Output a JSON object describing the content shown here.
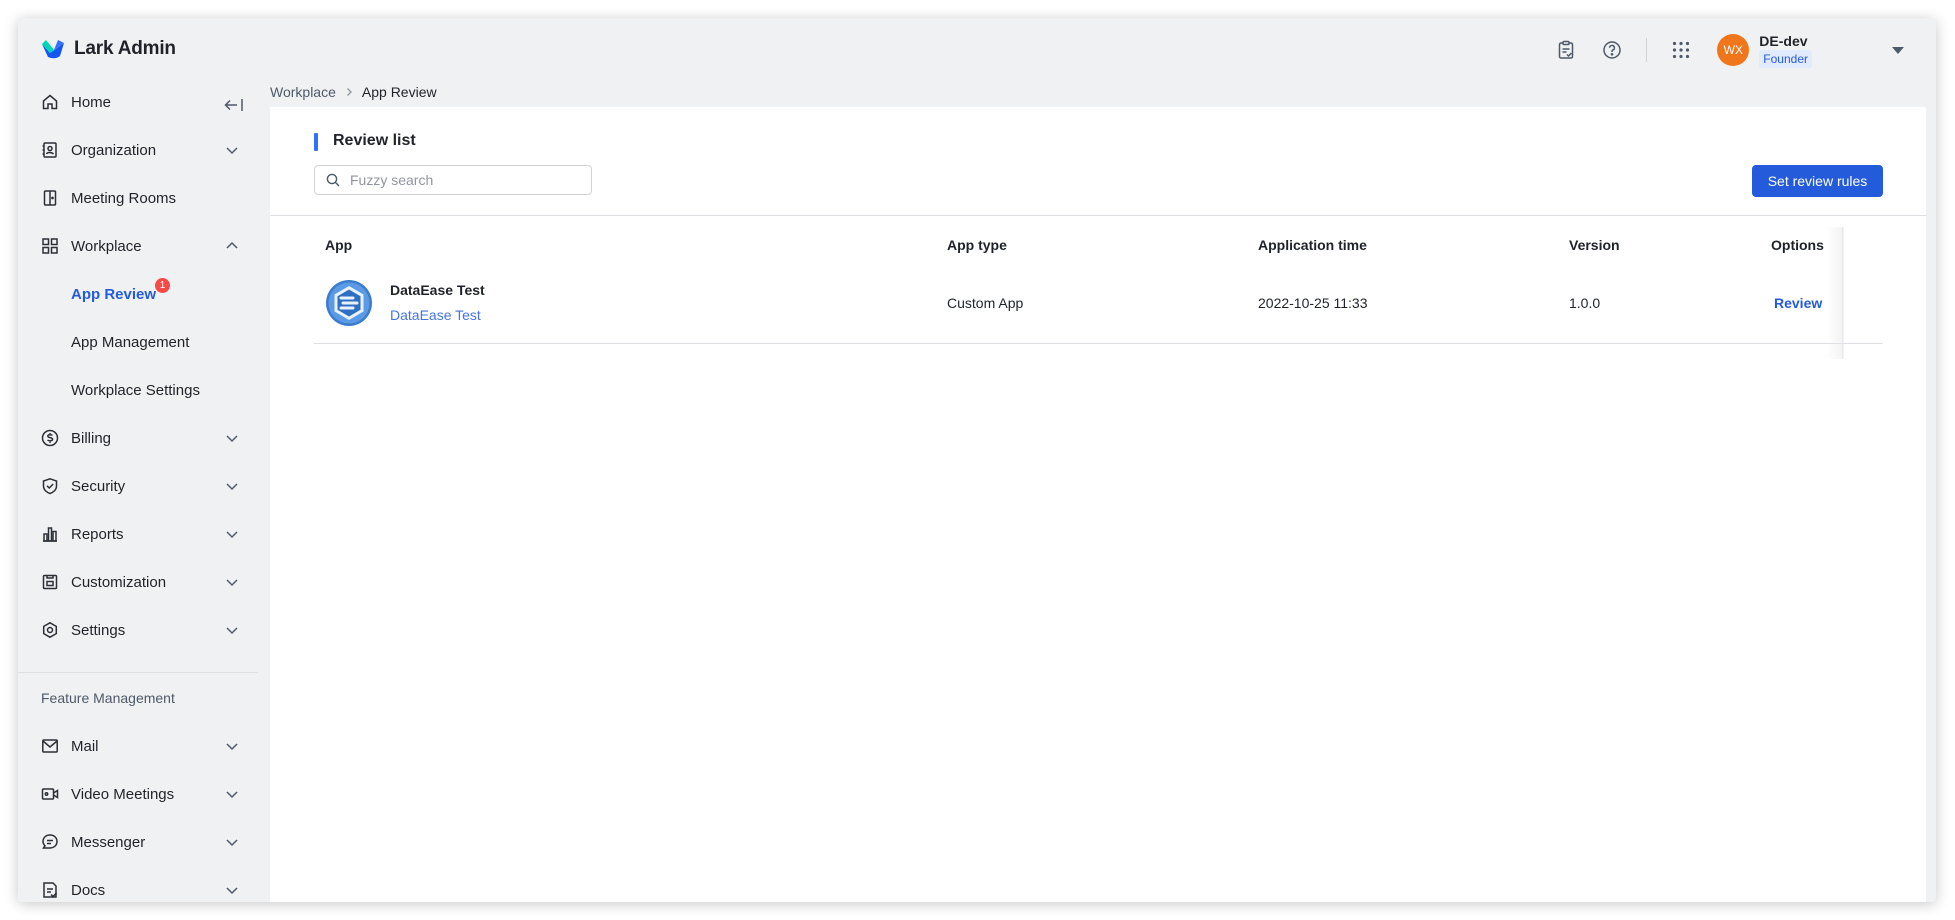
{
  "brand": {
    "name": "Lark Admin"
  },
  "topbar": {
    "icons": [
      "clipboard-check-icon",
      "help-icon",
      "app-grid-icon"
    ],
    "user": {
      "initials": "WX",
      "name": "DE-dev",
      "role": "Founder"
    }
  },
  "breadcrumb": {
    "parent": "Workplace",
    "current": "App Review"
  },
  "sidebar": {
    "items": [
      {
        "label": "Home",
        "icon": "home-icon"
      },
      {
        "label": "Organization",
        "icon": "organization-icon"
      },
      {
        "label": "Meeting Rooms",
        "icon": "meeting-rooms-icon"
      },
      {
        "label": "Workplace",
        "icon": "workplace-icon"
      },
      {
        "label": "Billing",
        "icon": "billing-icon"
      },
      {
        "label": "Security",
        "icon": "shield-icon"
      },
      {
        "label": "Reports",
        "icon": "reports-icon"
      },
      {
        "label": "Customization",
        "icon": "customization-icon"
      },
      {
        "label": "Settings",
        "icon": "settings-icon"
      }
    ],
    "workplace_sub": [
      {
        "label": "App Review",
        "badge": "1"
      },
      {
        "label": "App Management"
      },
      {
        "label": "Workplace Settings"
      }
    ],
    "section_label": "Feature Management",
    "feature_items": [
      {
        "label": "Mail",
        "icon": "mail-icon"
      },
      {
        "label": "Video Meetings",
        "icon": "video-icon"
      },
      {
        "label": "Messenger",
        "icon": "messenger-icon"
      },
      {
        "label": "Docs",
        "icon": "docs-icon"
      }
    ]
  },
  "main": {
    "title": "Review list",
    "search": {
      "placeholder": "Fuzzy search",
      "value": ""
    },
    "primary_button": "Set review rules",
    "table": {
      "headers": {
        "app": "App",
        "type": "App type",
        "time": "Application time",
        "version": "Version",
        "options": "Options"
      },
      "rows": [
        {
          "app_name": "DataEase Test",
          "app_sub": "DataEase Test",
          "type": "Custom App",
          "time": "2022-10-25 11:33",
          "version": "1.0.0",
          "action": "Review"
        }
      ]
    }
  },
  "colors": {
    "accent": "#245bdb",
    "badge": "#f54a45",
    "avatar": "#f0761b"
  }
}
